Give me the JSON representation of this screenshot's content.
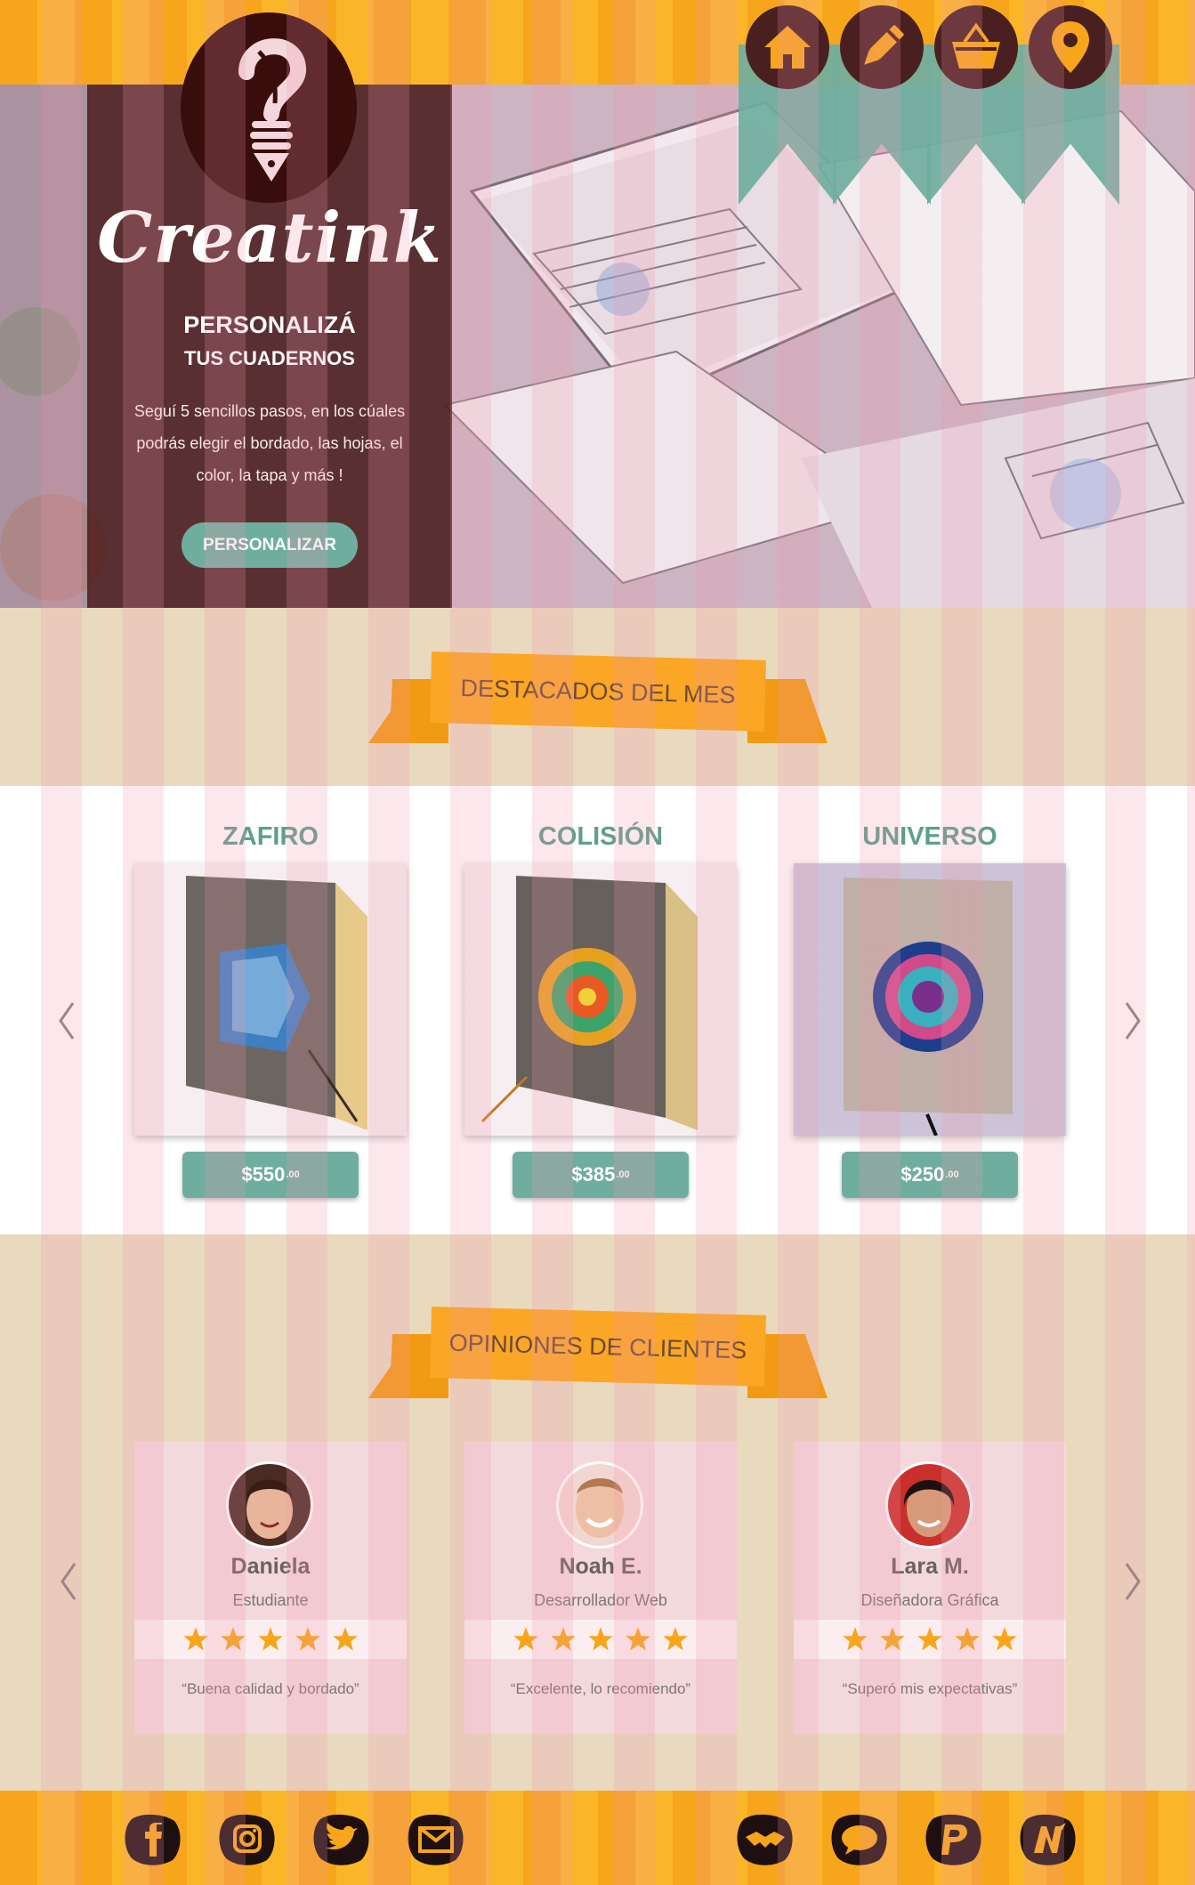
{
  "brand": {
    "name": "Creatink"
  },
  "nav": {
    "items": [
      {
        "icon": "home-icon"
      },
      {
        "icon": "pencil-icon"
      },
      {
        "icon": "basket-icon"
      },
      {
        "icon": "location-pin-icon"
      }
    ]
  },
  "hero": {
    "title": "PERSONALIZÁ",
    "subtitle": "TUS CUADERNOS",
    "description": "Seguí 5 sencillos pasos, en los cúales podrás elegir el bordado, las hojas, el color, la tapa y más !",
    "cta_label": "PERSONALIZAR"
  },
  "featured": {
    "heading": "DESTACADOS DEL MES",
    "products": [
      {
        "name": "ZAFIRO",
        "price": "$550",
        "cents": ".00"
      },
      {
        "name": "COLISIÓN",
        "price": "$385",
        "cents": ".00"
      },
      {
        "name": "UNIVERSO",
        "price": "$250",
        "cents": ".00"
      }
    ]
  },
  "reviews": {
    "heading": "OPINIONES DE CLIENTES",
    "items": [
      {
        "name": "Daniela",
        "role": "Estudiante",
        "stars": 5,
        "quote": "“Buena calidad y bordado”"
      },
      {
        "name": "Noah E.",
        "role": "Desarrollador Web",
        "stars": 5,
        "quote": "“Excelente, lo recomiendo”"
      },
      {
        "name": "Lara M.",
        "role": "Diseñadora Gráfica",
        "stars": 5,
        "quote": "“Superó mis expectativas”"
      }
    ]
  },
  "footer": {
    "social_left": [
      "facebook-icon",
      "instagram-icon",
      "twitter-icon",
      "mail-icon"
    ],
    "social_right": [
      "handshake-icon",
      "chat-icon",
      "paypal-icon",
      "payment-icon"
    ]
  },
  "colors": {
    "orange": "#f7a51a",
    "teal": "#6fae9f",
    "maroon": "#4a1f1f"
  }
}
